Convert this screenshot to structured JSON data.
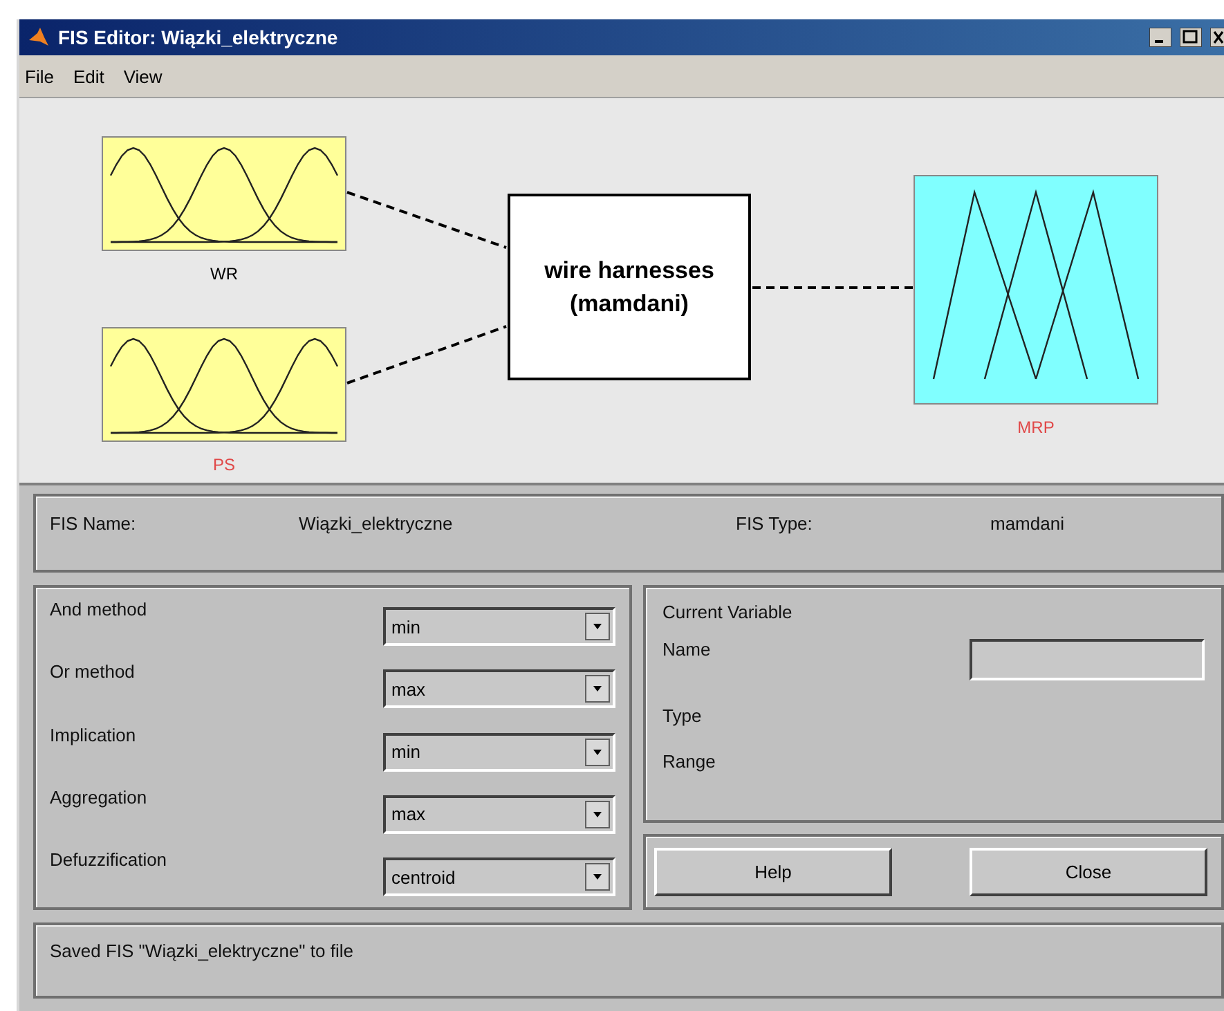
{
  "window": {
    "title": "FIS Editor: Wiązki_elektryczne"
  },
  "menu": [
    "File",
    "Edit",
    "View"
  ],
  "diagram": {
    "inputs": [
      {
        "name": "WR",
        "color": "#000000"
      },
      {
        "name": "PS",
        "color": "#e04848"
      }
    ],
    "system": {
      "name": "wire harnesses",
      "method": "(mamdani)"
    },
    "outputs": [
      {
        "name": "MRP",
        "color": "#e04848"
      }
    ]
  },
  "fis_info": {
    "name_label": "FIS Name:",
    "name": "Wiązki_elektryczne",
    "type_label": "FIS Type:",
    "type": "mamdani"
  },
  "methods": [
    {
      "label": "And method",
      "value": "min"
    },
    {
      "label": "Or method",
      "value": "max"
    },
    {
      "label": "Implication",
      "value": "min"
    },
    {
      "label": "Aggregation",
      "value": "max"
    },
    {
      "label": "Defuzzification",
      "value": "centroid"
    }
  ],
  "current_variable": {
    "title": "Current Variable",
    "fields": [
      {
        "label": "Name",
        "kind": "input"
      },
      {
        "label": "Type",
        "kind": "text"
      },
      {
        "label": "Range",
        "kind": "text"
      }
    ]
  },
  "buttons": [
    "Help",
    "Close"
  ],
  "status": "Saved FIS \"Wiązki_elektryczne\" to file"
}
